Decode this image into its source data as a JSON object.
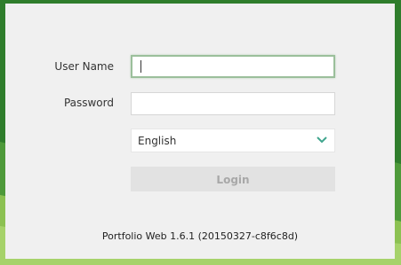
{
  "login_form": {
    "username_label": "User Name",
    "username_value": "",
    "password_label": "Password",
    "password_value": "",
    "language_selected": "English",
    "login_button_label": "Login"
  },
  "footer": {
    "version": "Portfolio Web 1.6.1 (20150327-c8f6c8d)"
  },
  "icons": {
    "language_dropdown": "chevron-down-icon"
  },
  "colors": {
    "background_green": "#2f7d2c",
    "panel": "#f0f0f0",
    "chevron": "#3fa58d",
    "focus_border": "#9bbf9b"
  }
}
